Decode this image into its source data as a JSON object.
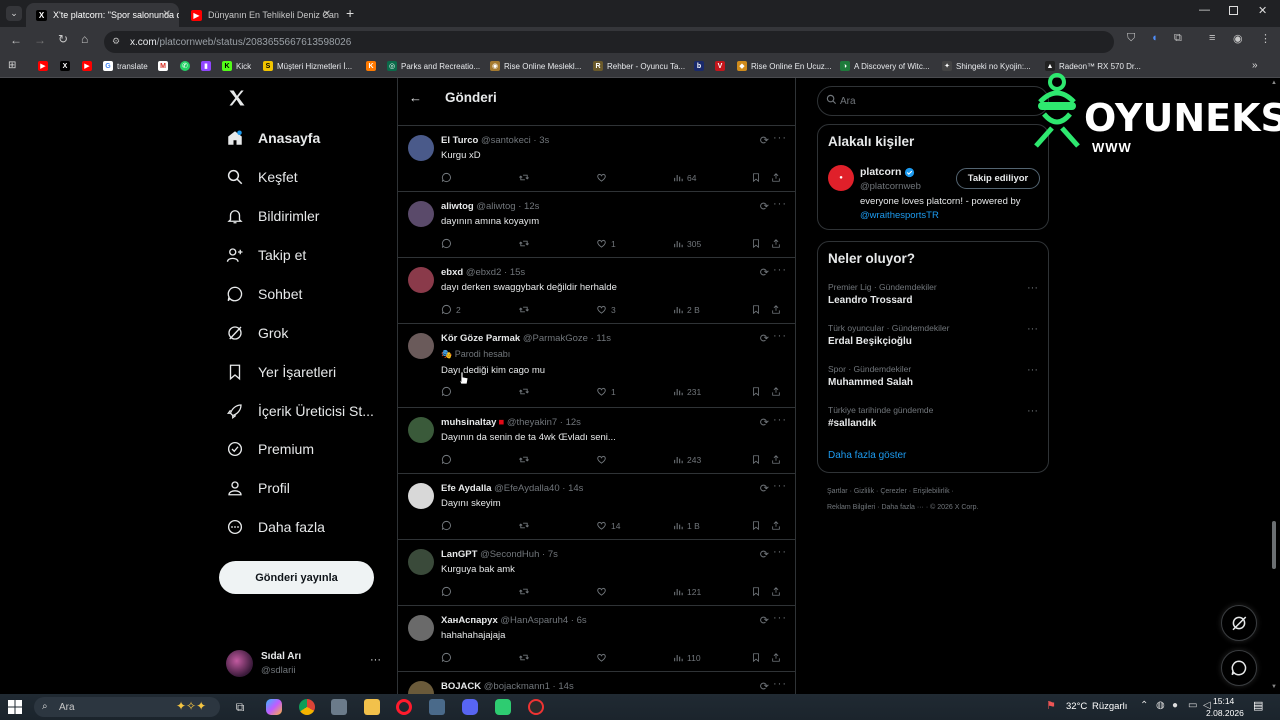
{
  "browser": {
    "tabs": [
      {
        "title": "X'te platcorn: \"Spor salonunda d",
        "active": true
      },
      {
        "title": "Dünyanın En Tehlikeli Deniz Can",
        "active": false
      }
    ],
    "url_domain": "x.com",
    "url_path": "/platcornweb/status/2083655667613598026",
    "bookmarks": [
      "translate",
      "Kick",
      "Müşteri Hizmetleri İ...",
      "Parks and Recreatio...",
      "Rise Online Meslekl...",
      "Rehber - Oyuncu Ta...",
      "Rise Online En Ucuz...",
      "A Discovery of Witc...",
      "Shingeki no Kyojin:...",
      "Radeon™ RX 570 Dr..."
    ]
  },
  "nav": {
    "items": [
      "Anasayfa",
      "Keşfet",
      "Bildirimler",
      "Takip et",
      "Sohbet",
      "Grok",
      "Yer İşaretleri",
      "İçerik Üreticisi St...",
      "Premium",
      "Profil",
      "Daha fazla"
    ],
    "post_button": "Gönderi yayınla",
    "account_name": "Sıdal Arı",
    "account_handle": "@sdlarii",
    "account_more": "···"
  },
  "center": {
    "title": "Gönderi",
    "tweets": [
      {
        "name": "El Turco",
        "handle": "@santokeci",
        "time": "3s",
        "text": "Kurgu xD",
        "replies": "",
        "retweets": "",
        "likes": "",
        "views": "64"
      },
      {
        "name": "aliwtog",
        "handle": "@aliwtog",
        "time": "12s",
        "text": "dayının amına koyayım",
        "replies": "",
        "retweets": "",
        "likes": "1",
        "views": "305"
      },
      {
        "name": "ebxd",
        "handle": "@ebxd2",
        "time": "15s",
        "text": "dayı derken swaggybark değildir herhalde",
        "replies": "2",
        "retweets": "",
        "likes": "3",
        "views": "2 B"
      },
      {
        "name": "Kör Göze Parmak",
        "handle": "@ParmakGoze",
        "time": "11s",
        "parody": "Parodi hesabı",
        "text": "Dayı dediği kim cago mu",
        "replies": "",
        "retweets": "",
        "likes": "1",
        "views": "231"
      },
      {
        "name": "muhsinaltay",
        "handle": "@theyakin7",
        "time": "12s",
        "text": "Dayının da senin de ta 4wk Œvladı seni...",
        "replies": "",
        "retweets": "",
        "likes": "",
        "views": "243"
      },
      {
        "name": "Efe Aydalla",
        "handle": "@EfeAydalla40",
        "time": "14s",
        "text": "Dayını skeyim",
        "replies": "",
        "retweets": "",
        "likes": "14",
        "views": "1 B"
      },
      {
        "name": "LanGPT",
        "handle": "@SecondHuh",
        "time": "7s",
        "text": "Kurguya bak amk",
        "replies": "",
        "retweets": "",
        "likes": "",
        "views": "121"
      },
      {
        "name": "ХанАспарух",
        "handle": "@HanAsparuh4",
        "time": "6s",
        "text": "hahahahajajaja",
        "replies": "",
        "retweets": "",
        "likes": "",
        "views": "110"
      },
      {
        "name": "BOJACK",
        "handle": "@bojackmann1",
        "time": "14s",
        "text": "",
        "replies": "",
        "retweets": "",
        "likes": "",
        "views": ""
      }
    ]
  },
  "right": {
    "search_placeholder": "Ara",
    "related_title": "Alakalı kişiler",
    "person": {
      "name": "platcorn",
      "handle": "@platcornweb",
      "follow_label": "Takip ediliyor",
      "bio": "everyone loves platcorn! - powered by",
      "bio_mention": "@wraithesportsTR"
    },
    "trends_title": "Neler oluyor?",
    "trends": [
      {
        "category": "Premier Lig · Gündemdekiler",
        "title": "Leandro Trossard"
      },
      {
        "category": "Türk oyuncular · Gündemdekiler",
        "title": "Erdal Beşikçioğlu"
      },
      {
        "category": "Spor · Gündemdekiler",
        "title": "Muhammed Salah"
      },
      {
        "category": "Türkiye tarihinde gündemde",
        "title": "#sallandık"
      }
    ],
    "show_more": "Daha fazla göster",
    "footer_line1": [
      "Şartlar",
      "Gizlilik",
      "Çerezler",
      "Erişilebilirlik"
    ],
    "footer_line2": [
      "Reklam Bilgileri",
      "Daha fazla ···",
      "© 2026 X Corp."
    ]
  },
  "overlay": {
    "logo_text": "OYUNEKS",
    "logo_sub": "WWW"
  },
  "taskbar": {
    "search_placeholder": "Ara",
    "weather": "32°C",
    "weather_label": "Rüzgarlı",
    "time": "15:14",
    "date": "2.08.2026"
  },
  "colors": {
    "accent": "#1d9bf0",
    "verified": "#1d9bf0",
    "text": "#e7e9ea",
    "muted": "#71767b",
    "logo_green": "#2ee86f"
  }
}
